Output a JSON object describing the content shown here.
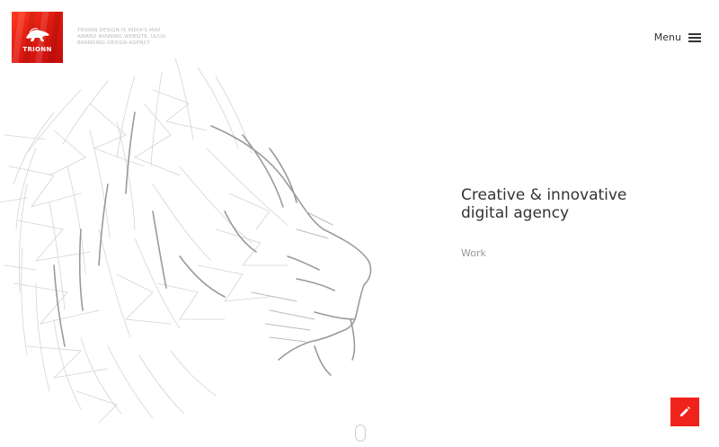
{
  "brand": {
    "logo_text": "TRIONN",
    "tagline": "TRIONN DESIGN IS INDIA'S MAX AWARD WINNING WEBSITE, UI/UX, BRANDING DESIGN AGENCY",
    "accent_color": "#f0231a"
  },
  "header": {
    "menu_label": "Menu",
    "menu_icon": "hamburger-icon"
  },
  "hero": {
    "headline_line1": "Creative & innovative",
    "headline_line2": "digital agency",
    "work_link": "Work",
    "illustration": "lion-line-art"
  },
  "footer": {
    "scroll_icon": "mouse-scroll-icon",
    "fab_icon": "pencil-icon"
  }
}
